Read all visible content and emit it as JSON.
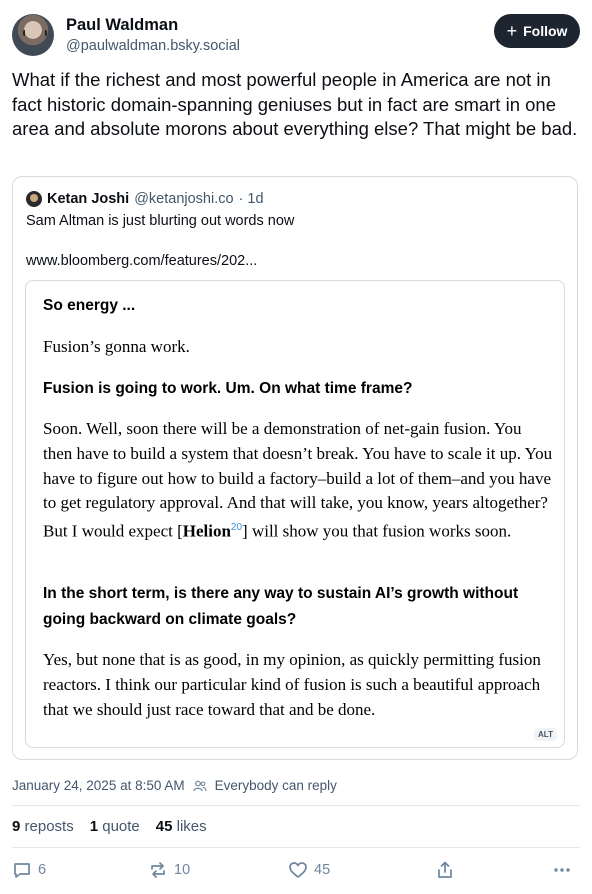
{
  "author": {
    "name": "Paul Waldman",
    "handle": "@paulwaldman.bsky.social"
  },
  "follow_label": "Follow",
  "post_text": "What if the richest and most powerful people in America are not in fact historic domain-spanning geniuses but in fact are smart in one area and absolute morons about everything else? That might be bad.",
  "quote": {
    "name": "Ketan Joshi",
    "handle": "@ketanjoshi.co",
    "time": "· 1d",
    "text": "Sam Altman is just blurting out words now",
    "link": "www.bloomberg.com/features/202..."
  },
  "embed": {
    "q1": "So energy ...",
    "a1": "Fusion’s gonna work.",
    "q2": "Fusion is going to work. Um. On what time frame?",
    "a2_before": "Soon. Well, soon there will be a demonstration of net-gain fusion. You then have to build a system that doesn’t break. You have to scale it up. You have to figure out how to build a factory–build a lot of them–and you have to get regulatory approval. And that will take, you know, years altogether? But I would expect [",
    "a2_bold": "Helion",
    "a2_sup": "20",
    "a2_after": "] will show you that fusion works soon.",
    "q3": "In the short term, is there any way to sustain AI’s growth without going backward on climate goals?",
    "a3": "Yes, but none that is as good, in my opinion, as quickly permitting fusion reactors. I think our particular kind of fusion is such a beautiful approach that we should just race toward that and be done.",
    "alt_badge": "ALT"
  },
  "meta": {
    "timestamp": "January 24, 2025 at 8:50 AM",
    "reply_setting": "Everybody can reply"
  },
  "stats": {
    "reposts_count": "9",
    "reposts_label": "reposts",
    "quotes_count": "1",
    "quotes_label": "quote",
    "likes_count": "45",
    "likes_label": "likes"
  },
  "actions": {
    "reply_count": "6",
    "repost_count": "10",
    "like_count": "45"
  },
  "icons": [
    "avatar",
    "plus-icon",
    "people-icon",
    "reply-icon",
    "repost-icon",
    "heart-icon",
    "share-icon",
    "more-icon"
  ]
}
